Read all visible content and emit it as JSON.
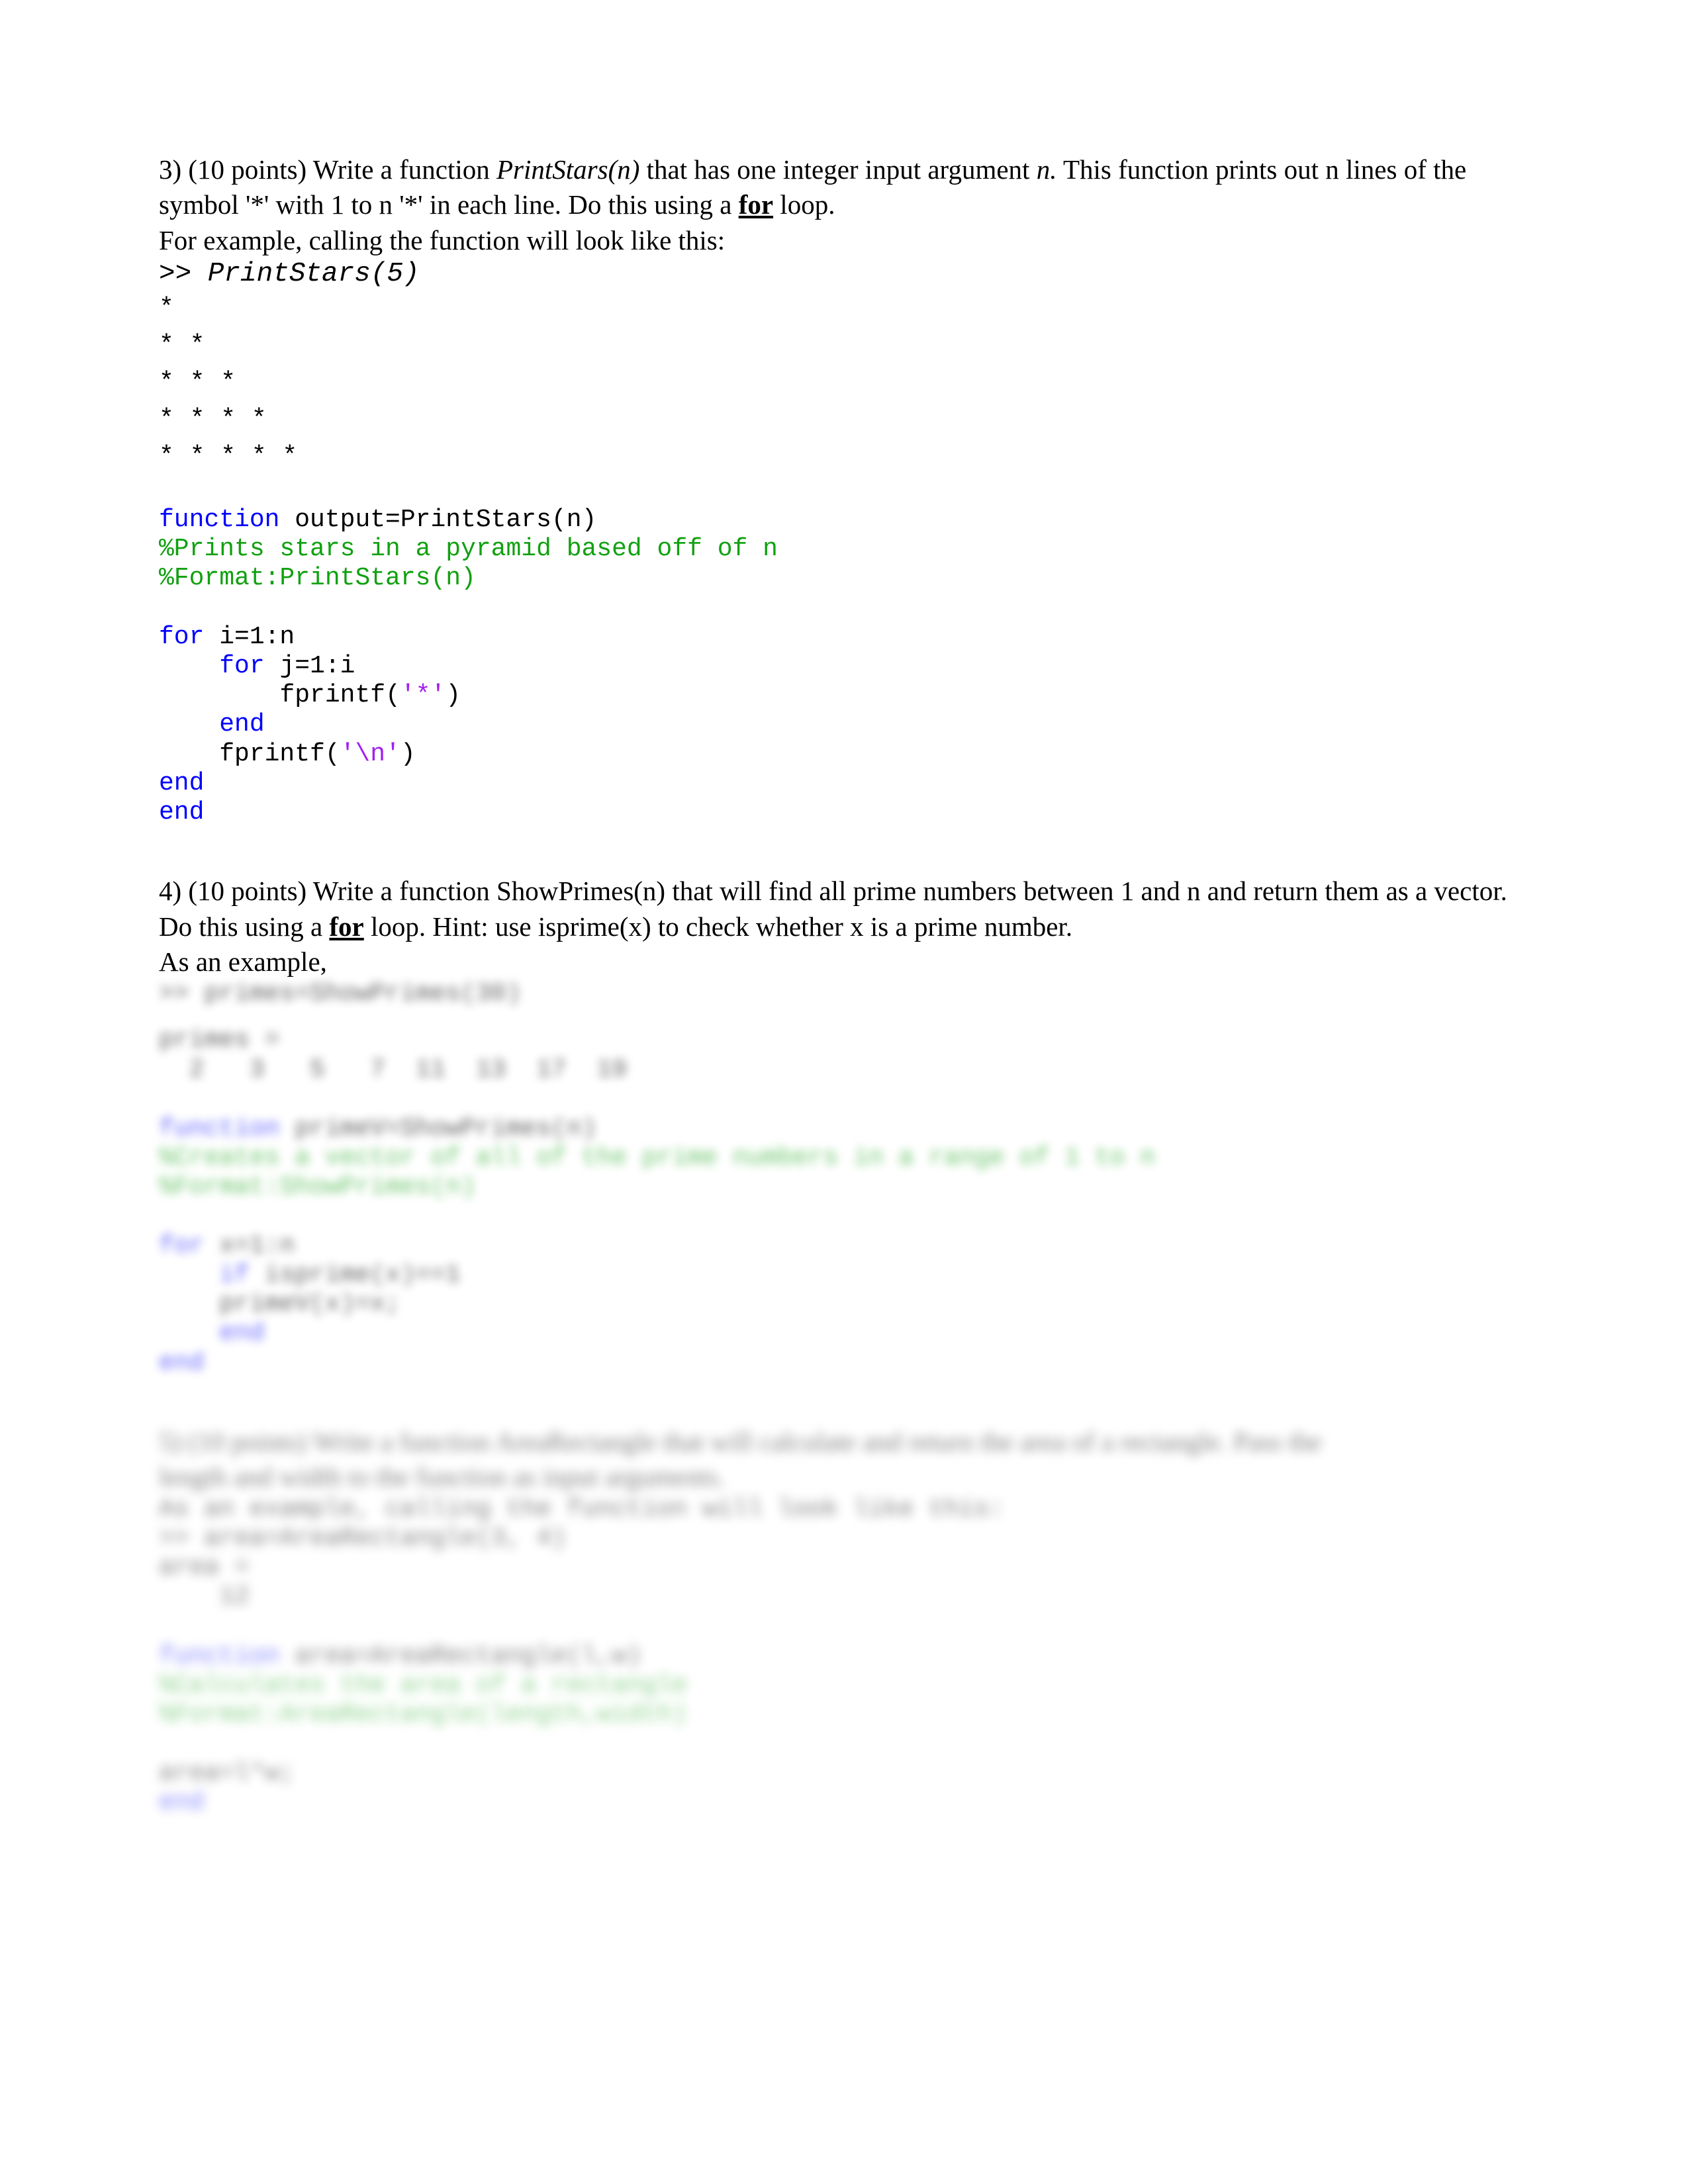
{
  "document": {
    "type": "matlab-homework-answers",
    "page_background": "#ffffff",
    "text_color": "#000000",
    "syntax_colors": {
      "keyword_blue": "#0000FF",
      "comment_green": "#11A111",
      "string_purple": "#A020F0",
      "plain_black": "#000000"
    }
  },
  "q3": {
    "paragraph_line1_pre": "3) (10 points) Write a function ",
    "paragraph_line1_italic": "PrintStars(n)",
    "paragraph_line1_mid": " that has one integer input argument ",
    "paragraph_line1_italic2": "n.",
    "paragraph_line1_post": " This function prints out n lines of the symbol '*' with 1 to n '*' in each line.  Do this using a ",
    "paragraph_for": "for",
    "paragraph_line1_tail": " loop.",
    "paragraph_line2": "For example, calling the function will look like this:",
    "prompt_symbol": ">> ",
    "prompt_command": "PrintStars(5)",
    "star_lines": [
      "*",
      "* *",
      "* * *",
      "* * * *",
      "* * * * *"
    ],
    "code_lines": [
      {
        "indent": 0,
        "parts": [
          {
            "t": "function ",
            "c": "kw"
          },
          {
            "t": "output=PrintStars(n)",
            "c": "plain"
          }
        ]
      },
      {
        "indent": 0,
        "parts": [
          {
            "t": "%Prints stars in a pyramid based off of n",
            "c": "cmt"
          }
        ]
      },
      {
        "indent": 0,
        "parts": [
          {
            "t": "%Format:PrintStars(n)",
            "c": "cmt"
          }
        ]
      },
      {
        "indent": 0,
        "parts": [
          {
            "t": "",
            "c": "plain"
          }
        ]
      },
      {
        "indent": 0,
        "parts": [
          {
            "t": "for ",
            "c": "kw"
          },
          {
            "t": "i=1:n",
            "c": "plain"
          }
        ]
      },
      {
        "indent": 1,
        "parts": [
          {
            "t": "for ",
            "c": "kw"
          },
          {
            "t": "j=1:i",
            "c": "plain"
          }
        ]
      },
      {
        "indent": 2,
        "parts": [
          {
            "t": "fprintf(",
            "c": "plain"
          },
          {
            "t": "'*'",
            "c": "str"
          },
          {
            "t": ")",
            "c": "plain"
          }
        ]
      },
      {
        "indent": 1,
        "parts": [
          {
            "t": "end",
            "c": "kw"
          }
        ]
      },
      {
        "indent": 1,
        "parts": [
          {
            "t": "fprintf(",
            "c": "plain"
          },
          {
            "t": "'\\n'",
            "c": "str"
          },
          {
            "t": ")",
            "c": "plain"
          }
        ]
      },
      {
        "indent": 0,
        "parts": [
          {
            "t": "end",
            "c": "kw"
          }
        ]
      },
      {
        "indent": 0,
        "parts": [
          {
            "t": "end",
            "c": "kw"
          }
        ]
      }
    ]
  },
  "q4": {
    "paragraph_pre": "4) (10 points) Write a function ShowPrimes(n) that will find all prime numbers between 1 and n and return them as a vector. Do this using a ",
    "paragraph_for": "for",
    "paragraph_post": " loop.  Hint: use isprime(x) to check whether x is a prime number.",
    "paragraph_example": "As an example,",
    "blurred": true,
    "blurred_note": "answer content is blurred/redacted in the source image",
    "console_lines": [
      ">> primes=ShowPrimes(30)",
      "primes =",
      "  2   3   5   7  11  13  17  19"
    ],
    "code_lines": [
      {
        "indent": 0,
        "parts": [
          {
            "t": "function ",
            "c": "kw"
          },
          {
            "t": "primeV=ShowPrimes(n)",
            "c": "plain"
          }
        ]
      },
      {
        "indent": 0,
        "parts": [
          {
            "t": "%Creates a vector of all of the prime numbers in a range of 1 to n",
            "c": "cmt"
          }
        ]
      },
      {
        "indent": 0,
        "parts": [
          {
            "t": "%Format:ShowPrimes(n)",
            "c": "cmt"
          }
        ]
      },
      {
        "indent": 0,
        "parts": [
          {
            "t": "",
            "c": "plain"
          }
        ]
      },
      {
        "indent": 0,
        "parts": [
          {
            "t": "for ",
            "c": "kw"
          },
          {
            "t": "x=1:n",
            "c": "plain"
          }
        ]
      },
      {
        "indent": 1,
        "parts": [
          {
            "t": "if ",
            "c": "kw"
          },
          {
            "t": "isprime(x)==1",
            "c": "plain"
          }
        ]
      },
      {
        "indent": 1,
        "parts": [
          {
            "t": "primeV(x)=x;",
            "c": "plain"
          }
        ]
      },
      {
        "indent": 1,
        "parts": [
          {
            "t": "end",
            "c": "kw"
          }
        ]
      },
      {
        "indent": 0,
        "parts": [
          {
            "t": "end",
            "c": "kw"
          }
        ]
      }
    ]
  },
  "q5": {
    "blurred": true,
    "blurred_note": "entire question and answer are blurred/redacted in the source image",
    "paragraph_lines": [
      "5) (10 points) Write a function AreaRectangle that will calculate and return the area of a rectangle.  Pass the",
      "length and width to the function as input arguments.",
      "As an example, calling the function will look like this:"
    ],
    "console_lines": [
      ">> area=AreaRectangle(3, 4)",
      "area =",
      "    12"
    ],
    "code_lines": [
      {
        "indent": 0,
        "parts": [
          {
            "t": "function ",
            "c": "kw"
          },
          {
            "t": "area=AreaRectangle(l,w)",
            "c": "plain"
          }
        ]
      },
      {
        "indent": 0,
        "parts": [
          {
            "t": "%Calculates the area of a rectangle",
            "c": "cmt"
          }
        ]
      },
      {
        "indent": 0,
        "parts": [
          {
            "t": "%Format:AreaRectangle(length,width)",
            "c": "cmt"
          }
        ]
      },
      {
        "indent": 0,
        "parts": [
          {
            "t": "",
            "c": "plain"
          }
        ]
      },
      {
        "indent": 0,
        "parts": [
          {
            "t": "area=l*w;",
            "c": "plain"
          }
        ]
      },
      {
        "indent": 0,
        "parts": [
          {
            "t": "end",
            "c": "kw"
          }
        ]
      }
    ]
  }
}
